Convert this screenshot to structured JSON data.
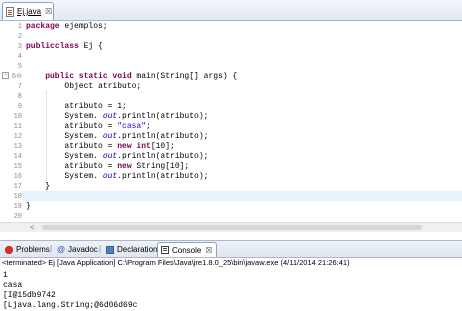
{
  "editor": {
    "tab": {
      "label": "Ej.java",
      "icon": "java-file-icon"
    },
    "lines": [
      {
        "n": "1",
        "segs": [
          [
            "kw",
            "package"
          ],
          [
            "",
            "ejemplos;"
          ]
        ]
      },
      {
        "n": "2",
        "segs": []
      },
      {
        "n": "3",
        "segs": [
          [
            "kw",
            "public"
          ],
          [
            "",
            ""
          ],
          [
            "kw",
            "class"
          ],
          [
            "",
            "Ej {"
          ]
        ]
      },
      {
        "n": "4",
        "segs": []
      },
      {
        "n": "5",
        "segs": []
      },
      {
        "n": "6⊖",
        "segs": [
          [
            "",
            "    "
          ],
          [
            "kw",
            "public static void"
          ],
          [
            "",
            "main(String[] args) {"
          ]
        ]
      },
      {
        "n": "7",
        "segs": [
          [
            "",
            "        Object atributo;"
          ]
        ]
      },
      {
        "n": "8",
        "segs": []
      },
      {
        "n": "9",
        "segs": [
          [
            "",
            "        atributo = 1;"
          ]
        ]
      },
      {
        "n": "10",
        "segs": [
          [
            "",
            "        System."
          ],
          [
            "fld",
            "out"
          ],
          [
            "",
            ".println(atributo);"
          ]
        ]
      },
      {
        "n": "11",
        "segs": [
          [
            "",
            "        atributo = "
          ],
          [
            "str",
            "\"casa\""
          ],
          [
            "",
            ";"
          ]
        ]
      },
      {
        "n": "12",
        "segs": [
          [
            "",
            "        System."
          ],
          [
            "fld",
            "out"
          ],
          [
            "",
            ".println(atributo);"
          ]
        ]
      },
      {
        "n": "13",
        "segs": [
          [
            "",
            "        atributo = "
          ],
          [
            "kw",
            "new int"
          ],
          [
            "",
            "[10];"
          ]
        ]
      },
      {
        "n": "14",
        "segs": [
          [
            "",
            "        System."
          ],
          [
            "fld",
            "out"
          ],
          [
            "",
            ".println(atributo);"
          ]
        ]
      },
      {
        "n": "15",
        "segs": [
          [
            "",
            "        atributo = "
          ],
          [
            "kw",
            "new"
          ],
          [
            "",
            "String[10];"
          ]
        ]
      },
      {
        "n": "16",
        "segs": [
          [
            "",
            "        System."
          ],
          [
            "fld",
            "out"
          ],
          [
            "",
            ".println(atributo);"
          ]
        ]
      },
      {
        "n": "17",
        "segs": [
          [
            "",
            "    }"
          ]
        ]
      },
      {
        "n": "18",
        "segs": []
      },
      {
        "n": "19",
        "segs": [
          [
            "",
            "}"
          ]
        ]
      },
      {
        "n": "20",
        "segs": []
      }
    ]
  },
  "views": {
    "tabs": [
      {
        "name": "problems",
        "label": "Problems",
        "icon": "problems-icon"
      },
      {
        "name": "javadoc",
        "label": "Javadoc",
        "icon": "javadoc-icon"
      },
      {
        "name": "declaration",
        "label": "Declaration",
        "icon": "declaration-icon"
      },
      {
        "name": "console",
        "label": "Console",
        "icon": "console-icon",
        "active": true
      }
    ]
  },
  "console": {
    "status": "<terminated> Ej [Java Application] C:\\Program Files\\Java\\jre1.8.0_25\\bin\\javaw.exe (4/11/2014 21:26:41)",
    "output": [
      "1",
      "casa",
      "[I@15db9742",
      "[Ljava.lang.String;@6d06d69c"
    ]
  },
  "colors": {
    "keyword": "#7f0055",
    "string": "#2a00ff",
    "field": "#0000c0",
    "current_line": "#e8f2fe",
    "line_number": "#8a8a8a"
  }
}
